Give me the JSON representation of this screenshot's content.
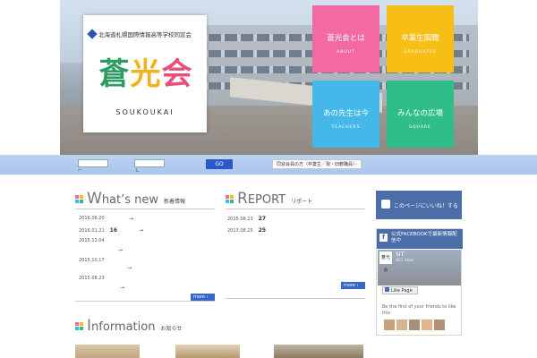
{
  "header": {
    "org_name": "北海道札幌国際情報高等学校同窓会",
    "logo": {
      "k1": "蒼",
      "k2": "光",
      "k3": "会",
      "roman": "SOUKOUKAI"
    }
  },
  "tiles": [
    {
      "jp": "蒼光会とは",
      "en": "ABOUT",
      "color": "#f36aa2"
    },
    {
      "jp": "卒業生図鑑",
      "en": "GRADUATES",
      "color": "#f7be16"
    },
    {
      "jp": "あの先生は今",
      "en": "TEACHERS",
      "color": "#45b8ea"
    },
    {
      "jp": "みんなの広場",
      "en": "SQUARE",
      "color": "#2fbd89"
    }
  ],
  "search": {
    "go_label": "GO",
    "member_label": "同窓会員の方（卒業生／現・旧教職員）",
    "member_arrow": "›"
  },
  "whatsnew": {
    "title_first": "W",
    "title_rest": "hat’s new",
    "sub": "新着情報",
    "items": [
      {
        "date": "2016.06.20",
        "num": "",
        "arrow": "→"
      },
      {
        "date": "2016.01.21",
        "num": "16",
        "arrow": "→"
      },
      {
        "date": "2015.11.04",
        "num": "",
        "arrow": "→"
      },
      {
        "date": "2015.10.17",
        "num": "",
        "arrow": "→"
      },
      {
        "date": "2015.08.23",
        "num": "",
        "arrow": "→"
      }
    ],
    "more": "more ›"
  },
  "report": {
    "title_first": "R",
    "title_rest": "EPORT",
    "sub": "リポート",
    "items": [
      {
        "date": "2015.08.23",
        "num": "27"
      },
      {
        "date": "2013.08.25",
        "num": "25"
      }
    ],
    "more": "more ›"
  },
  "information": {
    "title_first": "I",
    "title_rest": "nformation",
    "sub": "お知らせ"
  },
  "sidebar": {
    "like_label": "このページにいいね！する",
    "fb_head": "公式FACEBOOKで最新情報配信中",
    "fb_name": "SIT",
    "fb_likes": "951 likes",
    "fb_logo": "蒼光会",
    "fb_like_page": "Like Page",
    "fb_first": "Be the first of your friends to like this"
  },
  "colors": {
    "accent_blue": "#3566c8",
    "quad": [
      "#f36aa2",
      "#f7be16",
      "#45b8ea",
      "#2fbd89"
    ]
  }
}
